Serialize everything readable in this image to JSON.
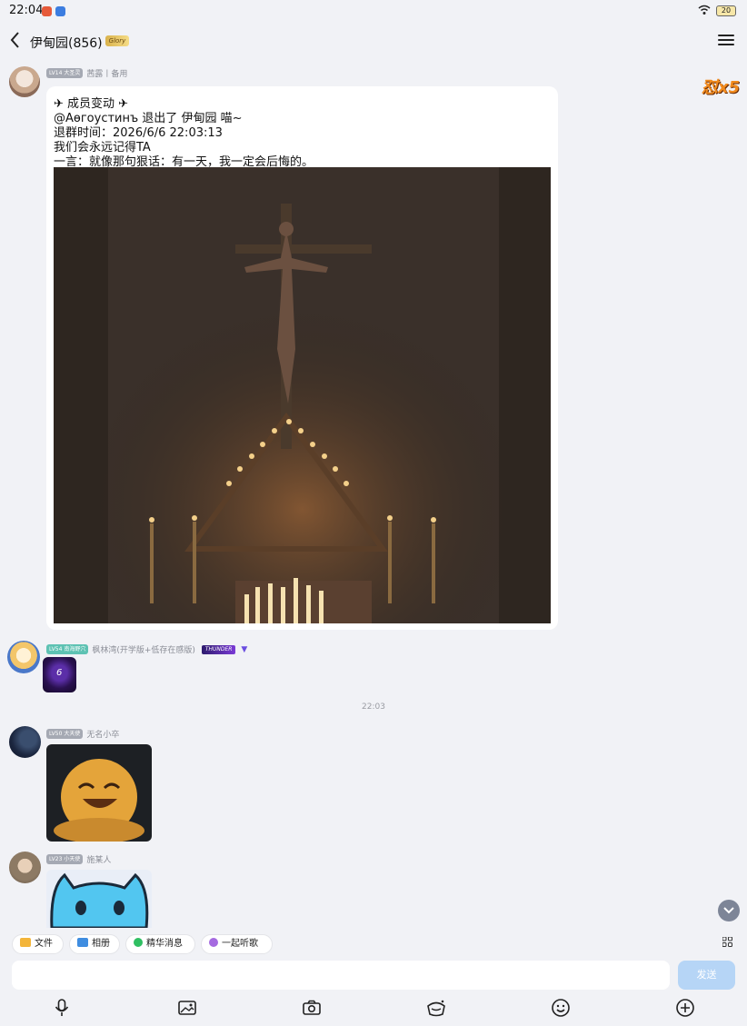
{
  "status_bar": {
    "time": "22:04",
    "battery": "20"
  },
  "header": {
    "title": "伊甸园(856)",
    "title_badge": "Glory"
  },
  "streak": "怼x5",
  "messages": [
    {
      "level": "LV14 大圣灵",
      "level_color": "#a5a9b3",
      "name": "茜露丨备用",
      "lines": [
        "✈ 成员变动 ✈",
        "@Аөгоустинъ 退出了 伊甸园 喵~",
        "退群时间：2026/6/6 22:03:13",
        "我们会永远记得TA",
        "一言：就像那句狠话：有一天，我一定会后悔的。"
      ]
    },
    {
      "level": "LV54 南海野穴",
      "level_color": "#5ec2b3",
      "name": "枫林湾(开学版+低存在感版)",
      "badge": "THUNDER",
      "sticker_text": "6"
    },
    {
      "level": "LV50 大天使",
      "level_color": "#a5a9b3",
      "name": "无名小卒"
    },
    {
      "level": "LV23 小天使",
      "level_color": "#a5a9b3",
      "name": "施某人"
    }
  ],
  "time_divider": "22:03",
  "quick_actions": [
    {
      "label": "文件",
      "color": "#f3b53a"
    },
    {
      "label": "相册",
      "color": "#3f8de0"
    },
    {
      "label": "精华消息",
      "color": "#2fbf62"
    },
    {
      "label": "一起听歌",
      "color": "#a56ae0"
    }
  ],
  "input": {
    "placeholder": ""
  },
  "send_label": "发送"
}
